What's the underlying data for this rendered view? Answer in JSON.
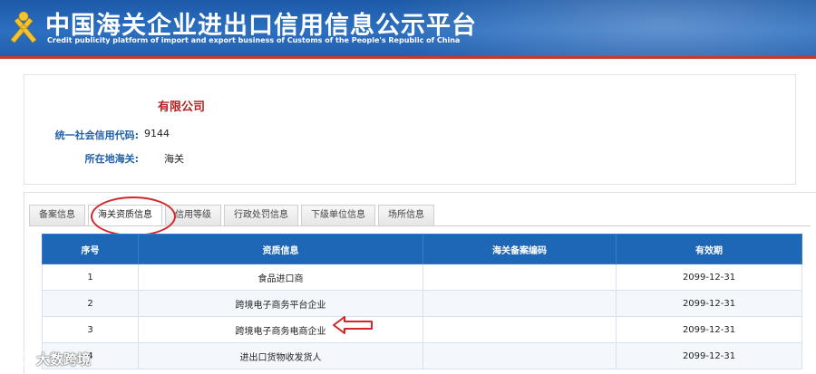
{
  "header": {
    "title_cn": "中国海关企业进出口信用信息公示平台",
    "title_en": "Credit publicity platform of import and export business of Customs of the People's Republic of China"
  },
  "company": {
    "name": "有限公司",
    "credit_code_label": "统一社会信用代码:",
    "credit_code_value": "9144",
    "customs_label": "所在地海关:",
    "customs_value": "海关"
  },
  "tabs": [
    {
      "label": "备案信息",
      "active": false
    },
    {
      "label": "海关资质信息",
      "active": true
    },
    {
      "label": "信用等级",
      "active": false
    },
    {
      "label": "行政处罚信息",
      "active": false
    },
    {
      "label": "下级单位信息",
      "active": false
    },
    {
      "label": "场所信息",
      "active": false
    }
  ],
  "table": {
    "headers": [
      "序号",
      "资质信息",
      "海关备案编码",
      "有效期"
    ],
    "rows": [
      [
        "1",
        "食品进口商",
        "",
        "2099-12-31"
      ],
      [
        "2",
        "跨境电子商务平台企业",
        "",
        "2099-12-31"
      ],
      [
        "3",
        "跨境电子商务电商企业",
        "",
        "2099-12-31"
      ],
      [
        "4",
        "进出口货物收发货人",
        "",
        "2099-12-31"
      ]
    ]
  },
  "watermark": {
    "text": "大数跨境"
  },
  "colors": {
    "header_blue": "#2c6fc0",
    "table_header_blue": "#1e67b7",
    "company_red": "#b22222",
    "label_blue": "#1f5fa8",
    "annotation_red": "#d1262a"
  }
}
